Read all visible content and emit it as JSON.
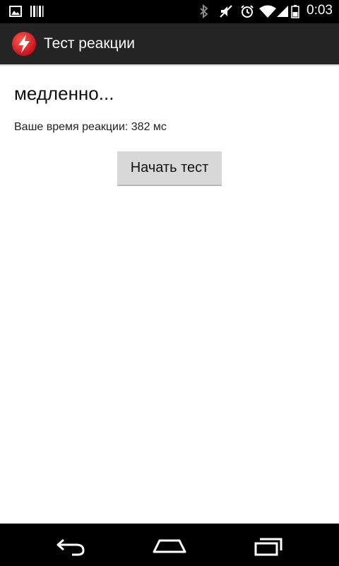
{
  "status_bar": {
    "time": "0:03",
    "icons": [
      "image-notification-icon",
      "barcode-notification-icon",
      "bluetooth-icon",
      "mute-icon",
      "alarm-icon",
      "wifi-icon",
      "signal-icon",
      "battery-icon"
    ]
  },
  "action_bar": {
    "title": "Тест реакции",
    "app_icon": "lightning-bolt-icon",
    "accent_color": "#e8232a"
  },
  "main": {
    "result_title": "медленно...",
    "result_text": "Ваше время реакции: 382 мс",
    "start_button_label": "Начать тест"
  },
  "nav_bar": {
    "icons": [
      "back-icon",
      "home-icon",
      "recent-apps-icon"
    ]
  }
}
